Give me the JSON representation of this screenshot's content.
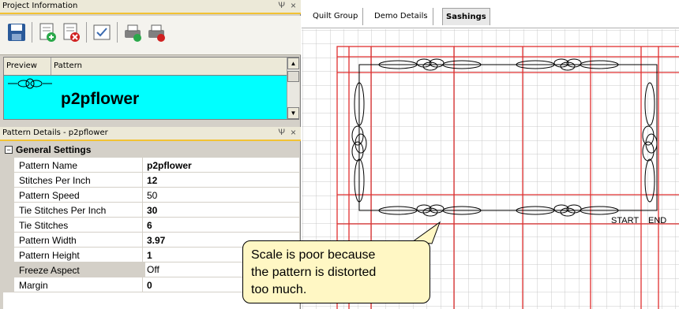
{
  "project_panel": {
    "title": "Project Information",
    "pin": "Ѱ",
    "close": "×",
    "toolbar": [
      "save-icon",
      "add-pattern-icon",
      "delete-pattern-icon",
      "check-pattern-icon",
      "print-icon",
      "remove-print-icon"
    ]
  },
  "pattern_grid": {
    "headers": [
      "Preview",
      "Pattern"
    ],
    "selected_row": {
      "name": "p2pflower"
    }
  },
  "details_panel": {
    "title": "Pattern Details - p2pflower",
    "pin": "Ѱ",
    "close": "×",
    "category": "General Settings",
    "expander": "−",
    "rows": [
      {
        "key": "Pattern Name",
        "value": "p2pflower"
      },
      {
        "key": "Stitches Per Inch",
        "value": "12"
      },
      {
        "key": "Pattern Speed",
        "value": "50"
      },
      {
        "key": "Tie Stitches Per Inch",
        "value": "30"
      },
      {
        "key": "Tie Stitches",
        "value": "6"
      },
      {
        "key": "Pattern Width",
        "value": "3.97"
      },
      {
        "key": "Pattern Height",
        "value": "1"
      },
      {
        "key": "Freeze Aspect",
        "value": "Off"
      },
      {
        "key": "Margin",
        "value": "0"
      }
    ]
  },
  "tabs": {
    "items": [
      "Quilt Group",
      "Demo Details",
      "Sashings"
    ],
    "active": "Sashings"
  },
  "canvas": {
    "start_label": "START",
    "end_label": "END",
    "grid_color": "#c8c8c8",
    "border_color": "#e03030"
  },
  "callout": {
    "lines": [
      "Scale is poor because",
      "the pattern is distorted",
      "too much."
    ]
  }
}
